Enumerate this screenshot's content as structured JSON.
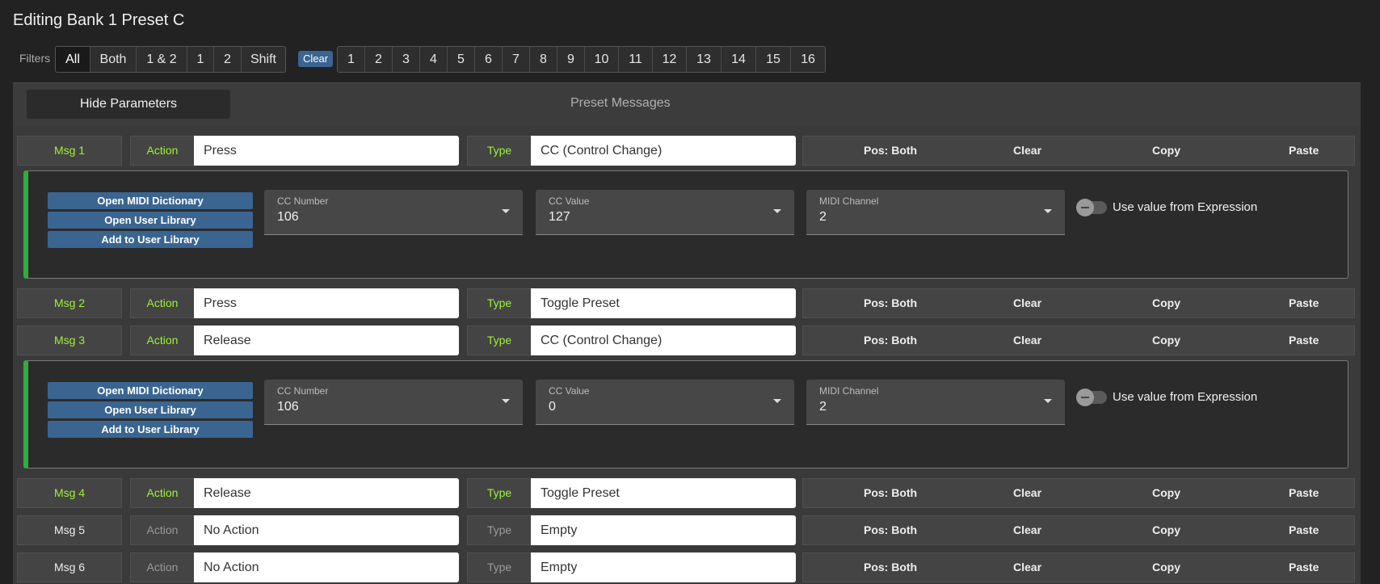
{
  "title": "Editing Bank 1 Preset C",
  "filters": {
    "label": "Filters",
    "position_options": [
      "All",
      "Both",
      "1 & 2",
      "1",
      "2",
      "Shift"
    ],
    "clear_label": "Clear",
    "channel_options": [
      "1",
      "2",
      "3",
      "4",
      "5",
      "6",
      "7",
      "8",
      "9",
      "10",
      "11",
      "12",
      "13",
      "14",
      "15",
      "16"
    ]
  },
  "panel": {
    "hide_button": "Hide Parameters",
    "title": "Preset Messages"
  },
  "messages": [
    {
      "msg": "Msg 1",
      "action_label": "Action",
      "action": "Press",
      "type_label": "Type",
      "type": "CC (Control Change)",
      "pos": "Pos: Both",
      "clear": "Clear",
      "copy": "Copy",
      "paste": "Paste"
    },
    {
      "msg": "Msg 2",
      "action_label": "Action",
      "action": "Press",
      "type_label": "Type",
      "type": "Toggle Preset",
      "pos": "Pos: Both",
      "clear": "Clear",
      "copy": "Copy",
      "paste": "Paste"
    },
    {
      "msg": "Msg 3",
      "action_label": "Action",
      "action": "Release",
      "type_label": "Type",
      "type": "CC (Control Change)",
      "pos": "Pos: Both",
      "clear": "Clear",
      "copy": "Copy",
      "paste": "Paste"
    },
    {
      "msg": "Msg 4",
      "action_label": "Action",
      "action": "Release",
      "type_label": "Type",
      "type": "Toggle Preset",
      "pos": "Pos: Both",
      "clear": "Clear",
      "copy": "Copy",
      "paste": "Paste"
    },
    {
      "msg": "Msg 5",
      "action_label": "Action",
      "action": "No Action",
      "type_label": "Type",
      "type": "Empty",
      "pos": "Pos: Both",
      "clear": "Clear",
      "copy": "Copy",
      "paste": "Paste"
    },
    {
      "msg": "Msg 6",
      "action_label": "Action",
      "action": "No Action",
      "type_label": "Type",
      "type": "Empty",
      "pos": "Pos: Both",
      "clear": "Clear",
      "copy": "Copy",
      "paste": "Paste"
    }
  ],
  "details": [
    {
      "open_dict": "Open MIDI Dictionary",
      "open_lib": "Open User Library",
      "add_lib": "Add to User Library",
      "cc_number_label": "CC Number",
      "cc_number": "106",
      "cc_value_label": "CC Value",
      "cc_value": "127",
      "channel_label": "MIDI Channel",
      "channel": "2",
      "expression_label": "Use value from Expression"
    },
    {
      "open_dict": "Open MIDI Dictionary",
      "open_lib": "Open User Library",
      "add_lib": "Add to User Library",
      "cc_number_label": "CC Number",
      "cc_number": "106",
      "cc_value_label": "CC Value",
      "cc_value": "0",
      "channel_label": "MIDI Channel",
      "channel": "2",
      "expression_label": "Use value from Expression"
    }
  ],
  "colors": {
    "active_label": "#9ef236",
    "accent_blue": "#3a6591",
    "detail_bar": "#2fae3c"
  }
}
